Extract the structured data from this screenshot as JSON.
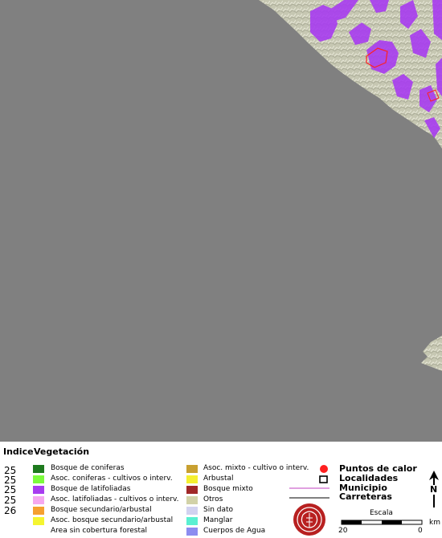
{
  "legend": {
    "header_index": "Indice",
    "header_vegetation": "Vegetación",
    "index_values": [
      "25",
      "25",
      "25",
      "25",
      "26"
    ],
    "vegetation_left": [
      {
        "label": "Bosque de coniferas",
        "color": "#1e7a1e"
      },
      {
        "label": "Asoc. coniferas - cultivos o interv.",
        "color": "#7cfc3c"
      },
      {
        "label": "Bosque de latifoliadas",
        "color": "#a83cf0"
      },
      {
        "label": "Asoc. latifoliadas - cultivos o interv.",
        "color": "#f5a8f0"
      },
      {
        "label": "Bosque secundario/arbustal",
        "color": "#f5a030"
      },
      {
        "label": "Asoc. bosque secundario/arbustal",
        "color": "#f5f530"
      },
      {
        "label": "Area sin cobertura forestal",
        "color": ""
      }
    ],
    "vegetation_right": [
      {
        "label": "Asoc. mixto - cultivo o interv.",
        "color": "#c8a030"
      },
      {
        "label": "Arbustal",
        "color": "#f5f030"
      },
      {
        "label": "Bosque mixto",
        "color": "#a02828"
      },
      {
        "label": "Otros",
        "color": "#d2d2a8"
      },
      {
        "label": "Sin dato",
        "color": "#d2d2f0"
      },
      {
        "label": "Manglar",
        "color": "#5af0d2"
      },
      {
        "label": "Cuerpos de Agua",
        "color": "#8c8cf0"
      }
    ],
    "symbols": {
      "hotspots": "Puntos de calor",
      "localities": "Localidades",
      "municipality": "Municipio",
      "roads": "Carreteras"
    },
    "scale": {
      "title": "Escala",
      "left_value": "20",
      "right_value": "0",
      "unit": "km"
    },
    "north_letter": "N"
  },
  "colors": {
    "ocean": "#808080",
    "land": "#c8c8b0",
    "broadleaf_forest": "#a83cf0",
    "hotspot": "#ff2020",
    "municipality_line": "#c040c0",
    "road_line": "#000000"
  }
}
